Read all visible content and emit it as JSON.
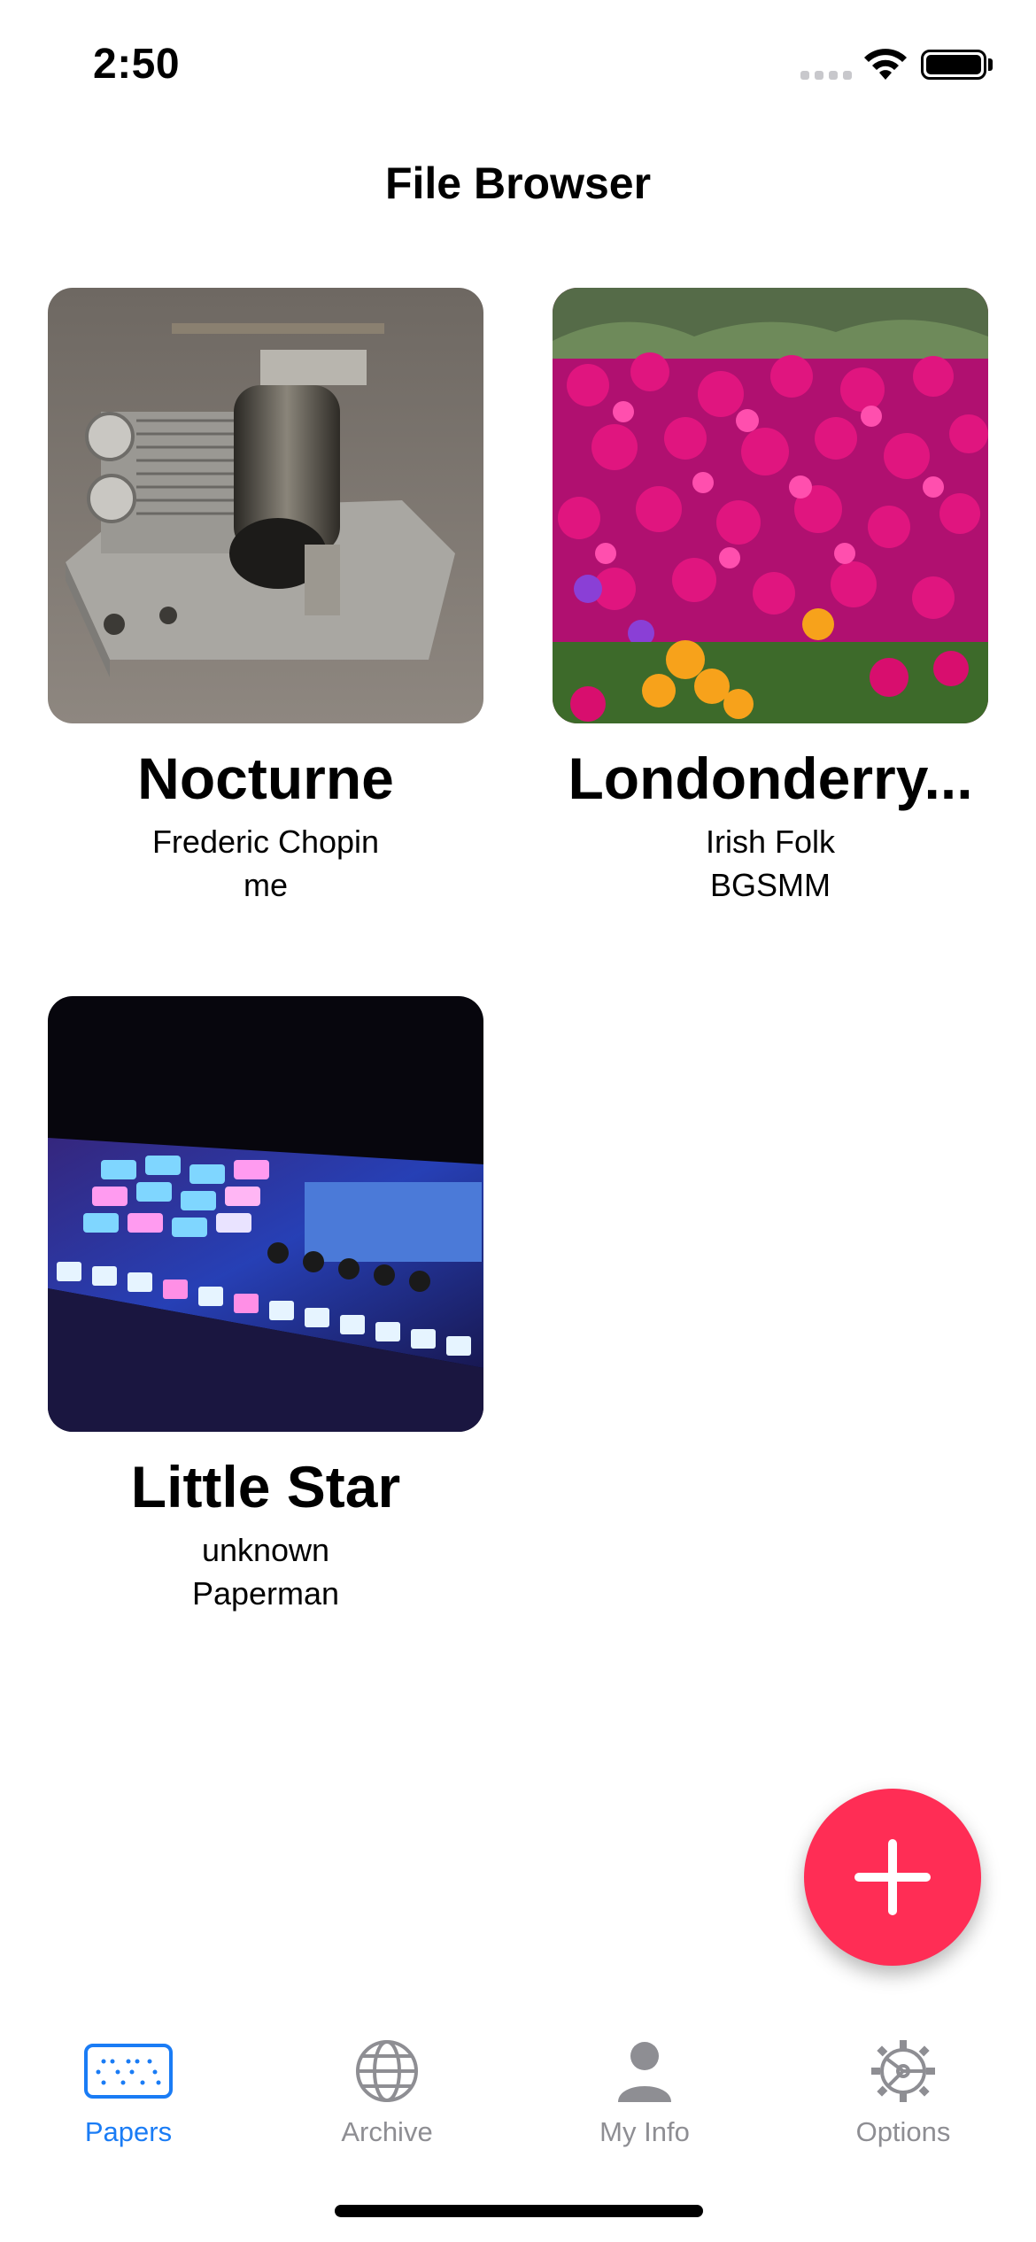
{
  "status_bar": {
    "time": "2:50"
  },
  "nav": {
    "title": "File Browser"
  },
  "cards": [
    {
      "title": "Nocturne",
      "line1": "Frederic Chopin",
      "line2": "me",
      "image": "music-box-photo"
    },
    {
      "title": "Londonderry...",
      "line1": "Irish Folk",
      "line2": "BGSMM",
      "image": "magenta-flowers-photo"
    },
    {
      "title": "Little Star",
      "line1": "unknown",
      "line2": "Paperman",
      "image": "drum-pad-controller-photo"
    }
  ],
  "fab": {
    "icon": "plus-icon",
    "color": "#ff2d55"
  },
  "tabs": [
    {
      "label": "Papers",
      "icon": "papers-icon",
      "active": true
    },
    {
      "label": "Archive",
      "icon": "globe-icon",
      "active": false
    },
    {
      "label": "My Info",
      "icon": "person-icon",
      "active": false
    },
    {
      "label": "Options",
      "icon": "gear-icon",
      "active": false
    }
  ],
  "colors": {
    "accent": "#1a7cf5",
    "inactive": "#8e8e93"
  }
}
